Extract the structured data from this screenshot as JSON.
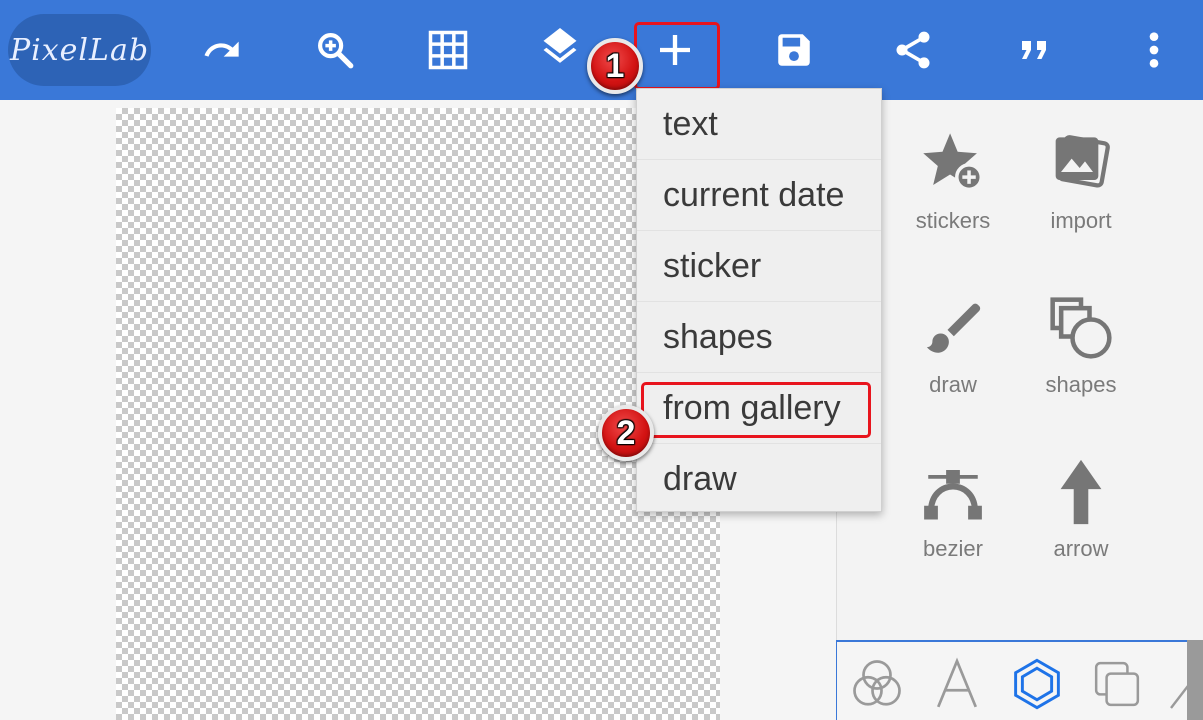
{
  "app": {
    "logo_text": "PixelLab"
  },
  "toolbar": {
    "buttons": [
      {
        "name": "undo",
        "icon": "undo-icon"
      },
      {
        "name": "zoom",
        "icon": "zoom-in-icon"
      },
      {
        "name": "grid",
        "icon": "grid-icon"
      },
      {
        "name": "layers",
        "icon": "layers-icon"
      },
      {
        "name": "add",
        "icon": "plus-icon"
      },
      {
        "name": "save",
        "icon": "save-icon"
      },
      {
        "name": "share",
        "icon": "share-icon"
      },
      {
        "name": "quote",
        "icon": "quote-icon"
      },
      {
        "name": "more",
        "icon": "more-vert-icon"
      }
    ]
  },
  "annotations": {
    "step1": "1",
    "step2": "2",
    "highlight_color": "#e8141d"
  },
  "menu": {
    "items": [
      {
        "label": "text"
      },
      {
        "label": "current date"
      },
      {
        "label": "sticker"
      },
      {
        "label": "shapes"
      },
      {
        "label": "from gallery"
      },
      {
        "label": "draw"
      }
    ]
  },
  "side_panel": {
    "tools": [
      {
        "label": "stickers",
        "icon": "star-add-icon"
      },
      {
        "label": "import",
        "icon": "image-import-icon"
      },
      {
        "label": "draw",
        "icon": "brush-icon"
      },
      {
        "label": "shapes",
        "icon": "shapes-icon"
      },
      {
        "label": "bezier",
        "icon": "bezier-icon"
      },
      {
        "label": "arrow",
        "icon": "arrow-up-icon"
      }
    ]
  },
  "bottom_tabs": [
    {
      "name": "blend",
      "icon": "blend-circles-icon"
    },
    {
      "name": "text",
      "icon": "letter-a-icon"
    },
    {
      "name": "shape",
      "icon": "hexagon-icon",
      "active": true
    },
    {
      "name": "layer",
      "icon": "copy-squares-icon"
    }
  ],
  "colors": {
    "toolbar": "#3a78d8",
    "accent": "#1e73e8",
    "icon_gray": "#767676"
  }
}
